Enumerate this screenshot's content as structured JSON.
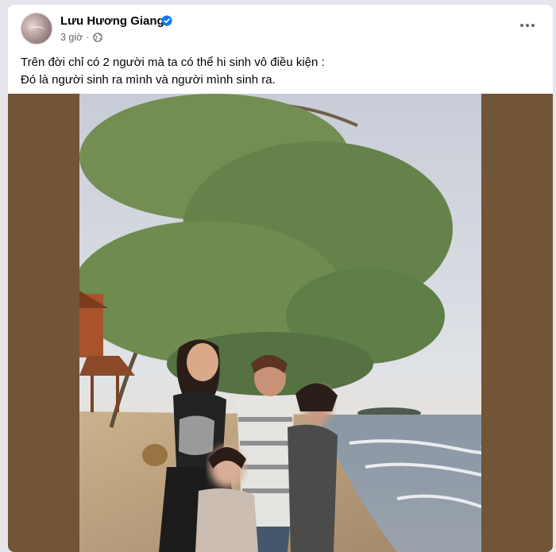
{
  "post": {
    "author_name": "Lưu Hương Giang",
    "timestamp": "3 giờ",
    "caption_line1": "Trên đời chỉ có 2 người mà ta có thể hi sinh vô điều kiện :",
    "caption_line2": "Đó là người sinh ra mình và người mình sinh ra."
  },
  "icons": {
    "verified": "verified-badge-icon",
    "audience": "globe-icon",
    "more": "more-options-icon"
  },
  "colors": {
    "verified_blue": "#1877f2",
    "media_backdrop": "#725436",
    "secondary_text": "#65676b"
  }
}
